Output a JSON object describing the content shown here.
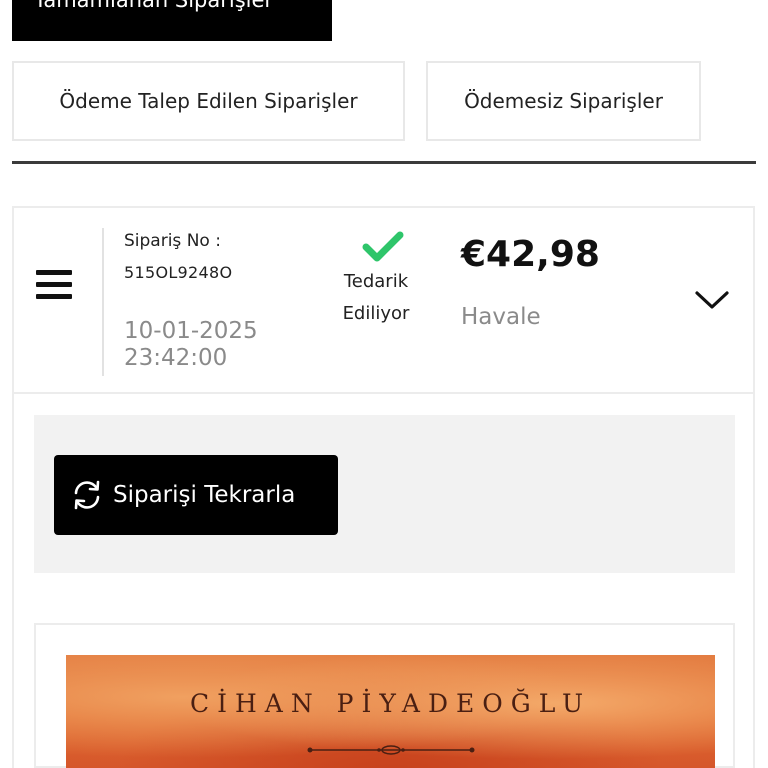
{
  "tabs": {
    "completed": "Tamamlanan Siparişler",
    "payment_requested": "Ödeme Talep Edilen Siparişler",
    "unpaid": "Ödemesiz Siparişler"
  },
  "order": {
    "number_label": "Sipariş No :",
    "number": "515OL9248O",
    "date": "10-01-2025",
    "time": "23:42:00",
    "status_line1": "Tedarik",
    "status_line2": "Ediliyor",
    "total": "€42,98",
    "payment_method": "Havale"
  },
  "actions": {
    "reorder_label": "Siparişi Tekrarla"
  },
  "product": {
    "cover_author": "CİHAN PİYADEOĞLU"
  },
  "icons": {
    "menu": "menu-icon",
    "status": "check-icon",
    "expand": "chevron-down-icon",
    "reorder": "refresh-icon"
  },
  "colors": {
    "status_green": "#2ec56a",
    "button_black": "#000000",
    "muted_text": "#8a8a8a"
  }
}
